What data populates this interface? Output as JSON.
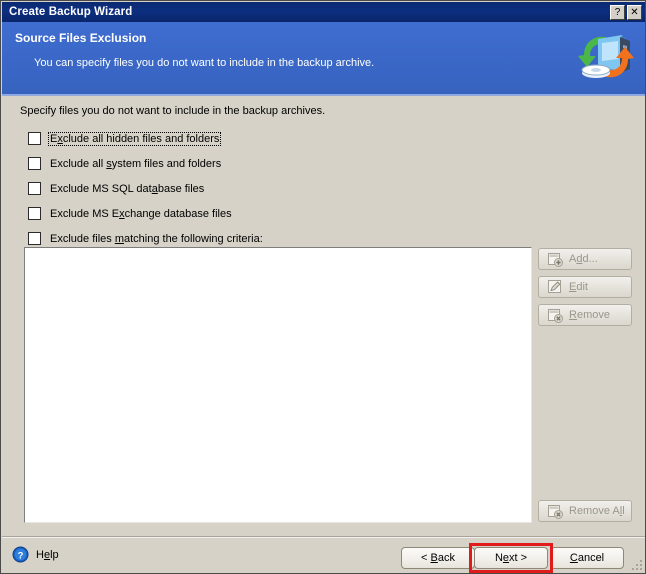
{
  "window": {
    "title": "Create Backup Wizard",
    "help_button": "?",
    "close_button": "✕"
  },
  "header": {
    "title": "Source Files Exclusion",
    "subtitle": "You can specify files you do not want to include in the backup archive.",
    "icon": "backup-wizard-icon",
    "background_color": "#3a68c8"
  },
  "main": {
    "instruction": "Specify files you do not want to include in the backup archives.",
    "checkboxes": [
      {
        "label_before": "E",
        "accel": "x",
        "label_after": "clude all hidden files and folders",
        "checked": false,
        "focused": true
      },
      {
        "label_before": "Exclude all ",
        "accel": "s",
        "label_after": "ystem files and folders",
        "checked": false,
        "focused": false
      },
      {
        "label_before": "Exclude MS SQL dat",
        "accel": "a",
        "label_after": "base files",
        "checked": false,
        "focused": false
      },
      {
        "label_before": "Exclude MS E",
        "accel": "x",
        "label_after": "change database files",
        "checked": false,
        "focused": false
      },
      {
        "label_before": "Exclude files ",
        "accel": "m",
        "label_after": "atching the following criteria:",
        "checked": false,
        "focused": false
      }
    ],
    "criteria_list": {
      "items": [],
      "empty": true
    },
    "side_buttons": [
      {
        "label_before": "A",
        "accel": "d",
        "label_after": "d...",
        "icon": "add-icon",
        "enabled": false
      },
      {
        "label_before": "",
        "accel": "E",
        "label_after": "dit",
        "icon": "edit-pencil-icon",
        "enabled": false
      },
      {
        "label_before": "",
        "accel": "R",
        "label_after": "emove",
        "icon": "remove-icon",
        "enabled": false
      }
    ],
    "remove_all_button": {
      "label_before": "Remove A",
      "accel": "l",
      "label_after": "l",
      "icon": "remove-all-icon",
      "enabled": false
    }
  },
  "footer": {
    "help": {
      "label_before": "H",
      "accel": "e",
      "label_after": "lp",
      "icon": "help-question-icon"
    },
    "back_button": {
      "label_before": "< ",
      "accel": "B",
      "label_after": "ack"
    },
    "next_button": {
      "label_before": "N",
      "accel": "e",
      "label_after": "xt >",
      "highlighted": true,
      "highlight_color": "#e01b1b"
    },
    "cancel_button": {
      "label_before": "",
      "accel": "C",
      "label_after": "ancel"
    },
    "resize_grip": "resize-grip-icon"
  }
}
